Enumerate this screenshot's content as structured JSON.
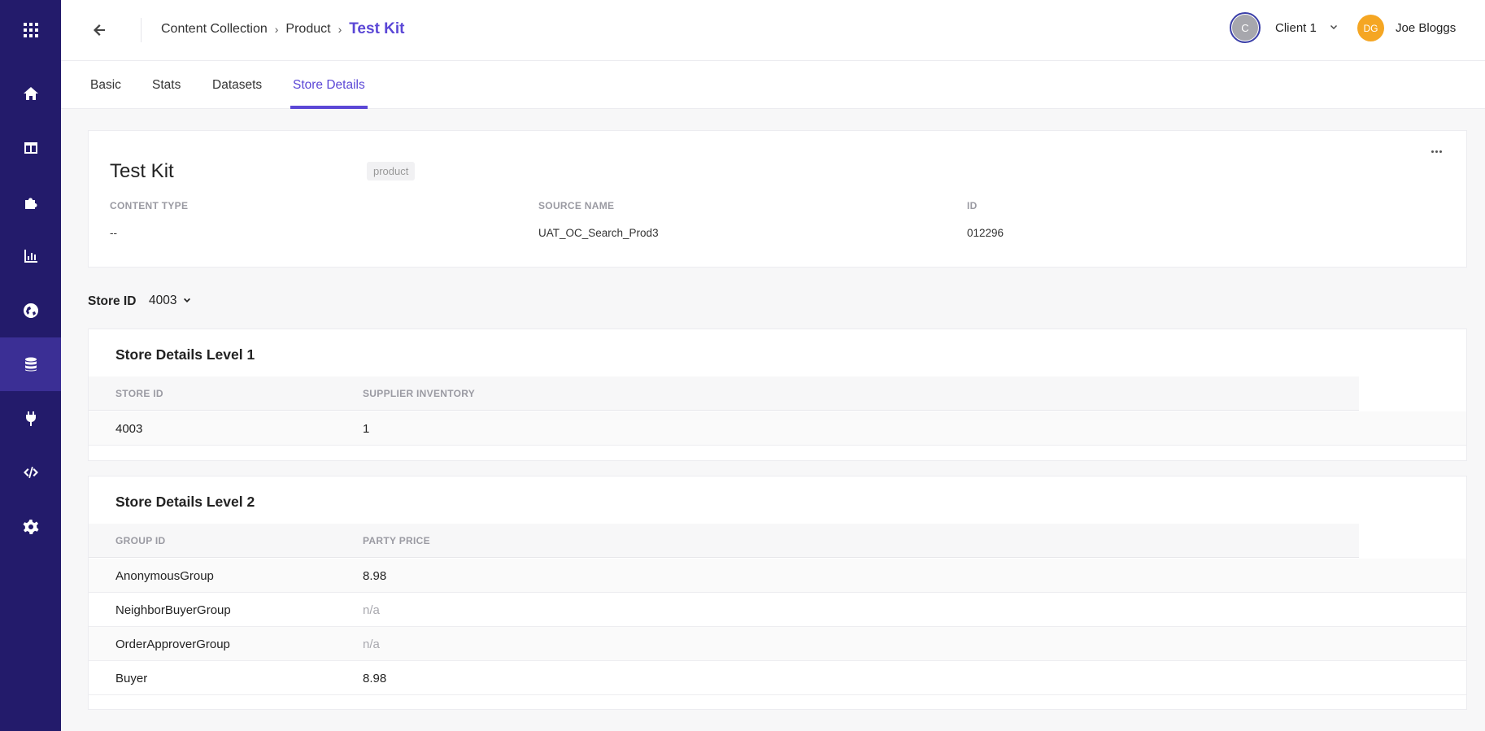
{
  "sidebar": {
    "items": [
      {
        "icon": "apps-grid-icon"
      },
      {
        "icon": "home-icon"
      },
      {
        "icon": "layout-icon"
      },
      {
        "icon": "puzzle-icon"
      },
      {
        "icon": "bar-chart-icon"
      },
      {
        "icon": "globe-icon"
      },
      {
        "icon": "database-icon",
        "active": true
      },
      {
        "icon": "plug-icon"
      },
      {
        "icon": "code-icon"
      },
      {
        "icon": "gear-icon"
      }
    ]
  },
  "header": {
    "breadcrumb": [
      "Content Collection",
      "Product",
      "Test Kit"
    ],
    "client": {
      "initial": "C",
      "name": "Client 1"
    },
    "user": {
      "initials": "DG",
      "name": "Joe Bloggs"
    },
    "accent_color": "#5b47d6"
  },
  "tabs": [
    "Basic",
    "Stats",
    "Datasets",
    "Store Details"
  ],
  "active_tab": "Store Details",
  "product": {
    "title": "Test Kit",
    "badge": "product",
    "fields": [
      {
        "label": "CONTENT TYPE",
        "value": "--"
      },
      {
        "label": "SOURCE NAME",
        "value": "UAT_OC_Search_Prod3"
      },
      {
        "label": "ID",
        "value": "012296"
      }
    ]
  },
  "store_selector": {
    "label": "Store ID",
    "value": "4003"
  },
  "level1": {
    "title": "Store Details Level 1",
    "columns": [
      "STORE ID",
      "SUPPLIER INVENTORY"
    ],
    "rows": [
      [
        "4003",
        "1"
      ]
    ]
  },
  "level2": {
    "title": "Store Details Level 2",
    "columns": [
      "GROUP ID",
      "PARTY PRICE"
    ],
    "rows": [
      [
        "AnonymousGroup",
        "8.98"
      ],
      [
        "NeighborBuyerGroup",
        "n/a"
      ],
      [
        "OrderApproverGroup",
        "n/a"
      ],
      [
        "Buyer",
        "8.98"
      ]
    ]
  }
}
